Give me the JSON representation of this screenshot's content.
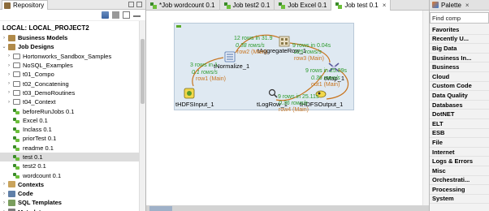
{
  "repository": {
    "tab_label": "Repository",
    "project_label": "LOCAL: LOCAL_PROJECT2",
    "tree": [
      {
        "label": "Business Models",
        "indent": 0,
        "type": "cat",
        "bold": true,
        "twisty": "›"
      },
      {
        "label": "Job Designs",
        "indent": 0,
        "type": "cat",
        "bold": true,
        "twisty": "⌄"
      },
      {
        "label": "Hortonworks_Sandbox_Samples",
        "indent": 1,
        "type": "folder",
        "twisty": "›"
      },
      {
        "label": "NoSQL_Examples",
        "indent": 1,
        "type": "folder",
        "twisty": "›"
      },
      {
        "label": "t01_Compo",
        "indent": 1,
        "type": "folder",
        "twisty": "›"
      },
      {
        "label": "t02_Concatening",
        "indent": 1,
        "type": "folder",
        "twisty": "›"
      },
      {
        "label": "t03_DemoRoutines",
        "indent": 1,
        "type": "folder",
        "twisty": "›"
      },
      {
        "label": "t04_Context",
        "indent": 1,
        "type": "folder",
        "twisty": "›"
      },
      {
        "label": "beforeRunJobs 0.1",
        "indent": 1,
        "type": "job"
      },
      {
        "label": "Excel 0.1",
        "indent": 1,
        "type": "job"
      },
      {
        "label": "Inclass 0.1",
        "indent": 1,
        "type": "job"
      },
      {
        "label": "priorTest 0.1",
        "indent": 1,
        "type": "job"
      },
      {
        "label": "readme 0.1",
        "indent": 1,
        "type": "job"
      },
      {
        "label": "test 0.1",
        "indent": 1,
        "type": "job",
        "selected": true
      },
      {
        "label": "test2 0.1",
        "indent": 1,
        "type": "job"
      },
      {
        "label": "wordcount 0.1",
        "indent": 1,
        "type": "job"
      },
      {
        "label": "Contexts",
        "indent": 0,
        "type": "ctx",
        "bold": true,
        "twisty": "›"
      },
      {
        "label": "Code",
        "indent": 0,
        "type": "code",
        "bold": true,
        "twisty": "›"
      },
      {
        "label": "SQL Templates",
        "indent": 0,
        "type": "sql",
        "bold": true,
        "twisty": "›"
      },
      {
        "label": "Metadata",
        "indent": 0,
        "type": "meta",
        "bold": true,
        "twisty": "›"
      }
    ]
  },
  "editor_tabs": [
    {
      "label": "*Job wordcount 0.1",
      "active": false
    },
    {
      "label": "Job test2 0.1",
      "active": false
    },
    {
      "label": "Job Excel 0.1",
      "active": false
    },
    {
      "label": "Job test 0.1",
      "active": true
    }
  ],
  "canvas": {
    "components": {
      "thdfsinput": "tHDFSInput_1",
      "tnormalize": "tNormalize_1",
      "taggregate": "tAggregateRow_1",
      "tmap": "tMap_1",
      "tlogrow": "tLogRow_1",
      "thdfsoutput": "tHDFSOutput_1"
    },
    "flows": {
      "row1": {
        "stat": "3 rows in 1",
        "rate": "0.1 rows/s",
        "name": "row1 (Main)"
      },
      "row2": {
        "stat": "12 rows in 31.9",
        "rate": "0.38 rows/s",
        "name": "row2 (Main)"
      },
      "row3": {
        "stat": "9 rows in 0.04s",
        "rate": "225 rows/s",
        "name": "row3 (Main)"
      },
      "out1": {
        "stat": "9 rows in 25.09s",
        "rate": "0.36 rows/s",
        "name": "out1 (Main)"
      },
      "row4": {
        "stat": "9 rows in 25.11s",
        "rate": "0.36 rows/s",
        "name": "row4 (Main)"
      }
    }
  },
  "palette": {
    "title": "Palette",
    "search_value": "Find comp",
    "items": [
      "Favorites",
      "Recently U...",
      "Big Data",
      "Business In...",
      "Business",
      "Cloud",
      "Custom Code",
      "Data Quality",
      "Databases",
      "DotNET",
      "ELT",
      "ESB",
      "File",
      "Internet",
      "Logs & Errors",
      "Misc",
      "Orchestrati...",
      "Processing",
      "System"
    ]
  },
  "colors": {
    "flow": "#c8741e",
    "stats": "#2a9a2a",
    "subjob_bg": "#dfe9f2"
  }
}
